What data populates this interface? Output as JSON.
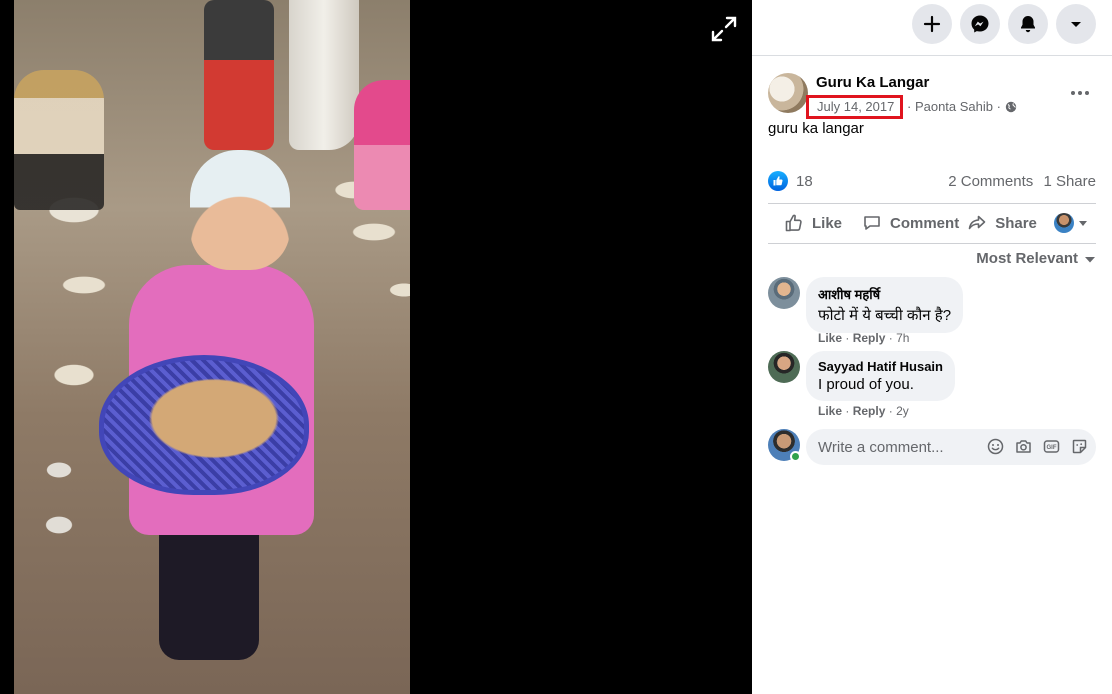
{
  "viewer": {
    "photo_alt": "guru ka langar",
    "expand_label": "expand"
  },
  "topbar": {
    "buttons": [
      {
        "icon": "plus-icon"
      },
      {
        "icon": "messenger-icon"
      },
      {
        "icon": "bell-icon"
      },
      {
        "icon": "caret-down-icon"
      }
    ]
  },
  "post": {
    "page_name": "Guru Ka Langar",
    "date": "July 14, 2017",
    "separator": "·",
    "location": "Paonta Sahib",
    "privacy_icon": "globe-icon",
    "caption": "guru ka langar",
    "reaction_count": "18",
    "comments_count": "2 Comments",
    "shares_count": "1 Share",
    "highlight_color": "#e0141e"
  },
  "actions": {
    "like": "Like",
    "comment": "Comment",
    "share": "Share"
  },
  "comments_section": {
    "sort_label": "Most Relevant",
    "comments": [
      {
        "author": "आशीष महर्षि",
        "text": "फोटो में ये बच्ची कौन है?",
        "like": "Like",
        "reply": "Reply",
        "time": "7h",
        "sep": "·"
      },
      {
        "author": "Sayyad Hatif Husain",
        "text": "I proud of you.",
        "like": "Like",
        "reply": "Reply",
        "time": "2y",
        "sep": "·"
      }
    ],
    "write_placeholder": "Write a comment...",
    "composer_icons": [
      "emoji-icon",
      "camera-icon",
      "gif-icon",
      "sticker-icon"
    ]
  },
  "colors": {
    "accent": "#1877f2",
    "secondary_text": "#65676b",
    "bubble_bg": "#f0f2f5"
  }
}
